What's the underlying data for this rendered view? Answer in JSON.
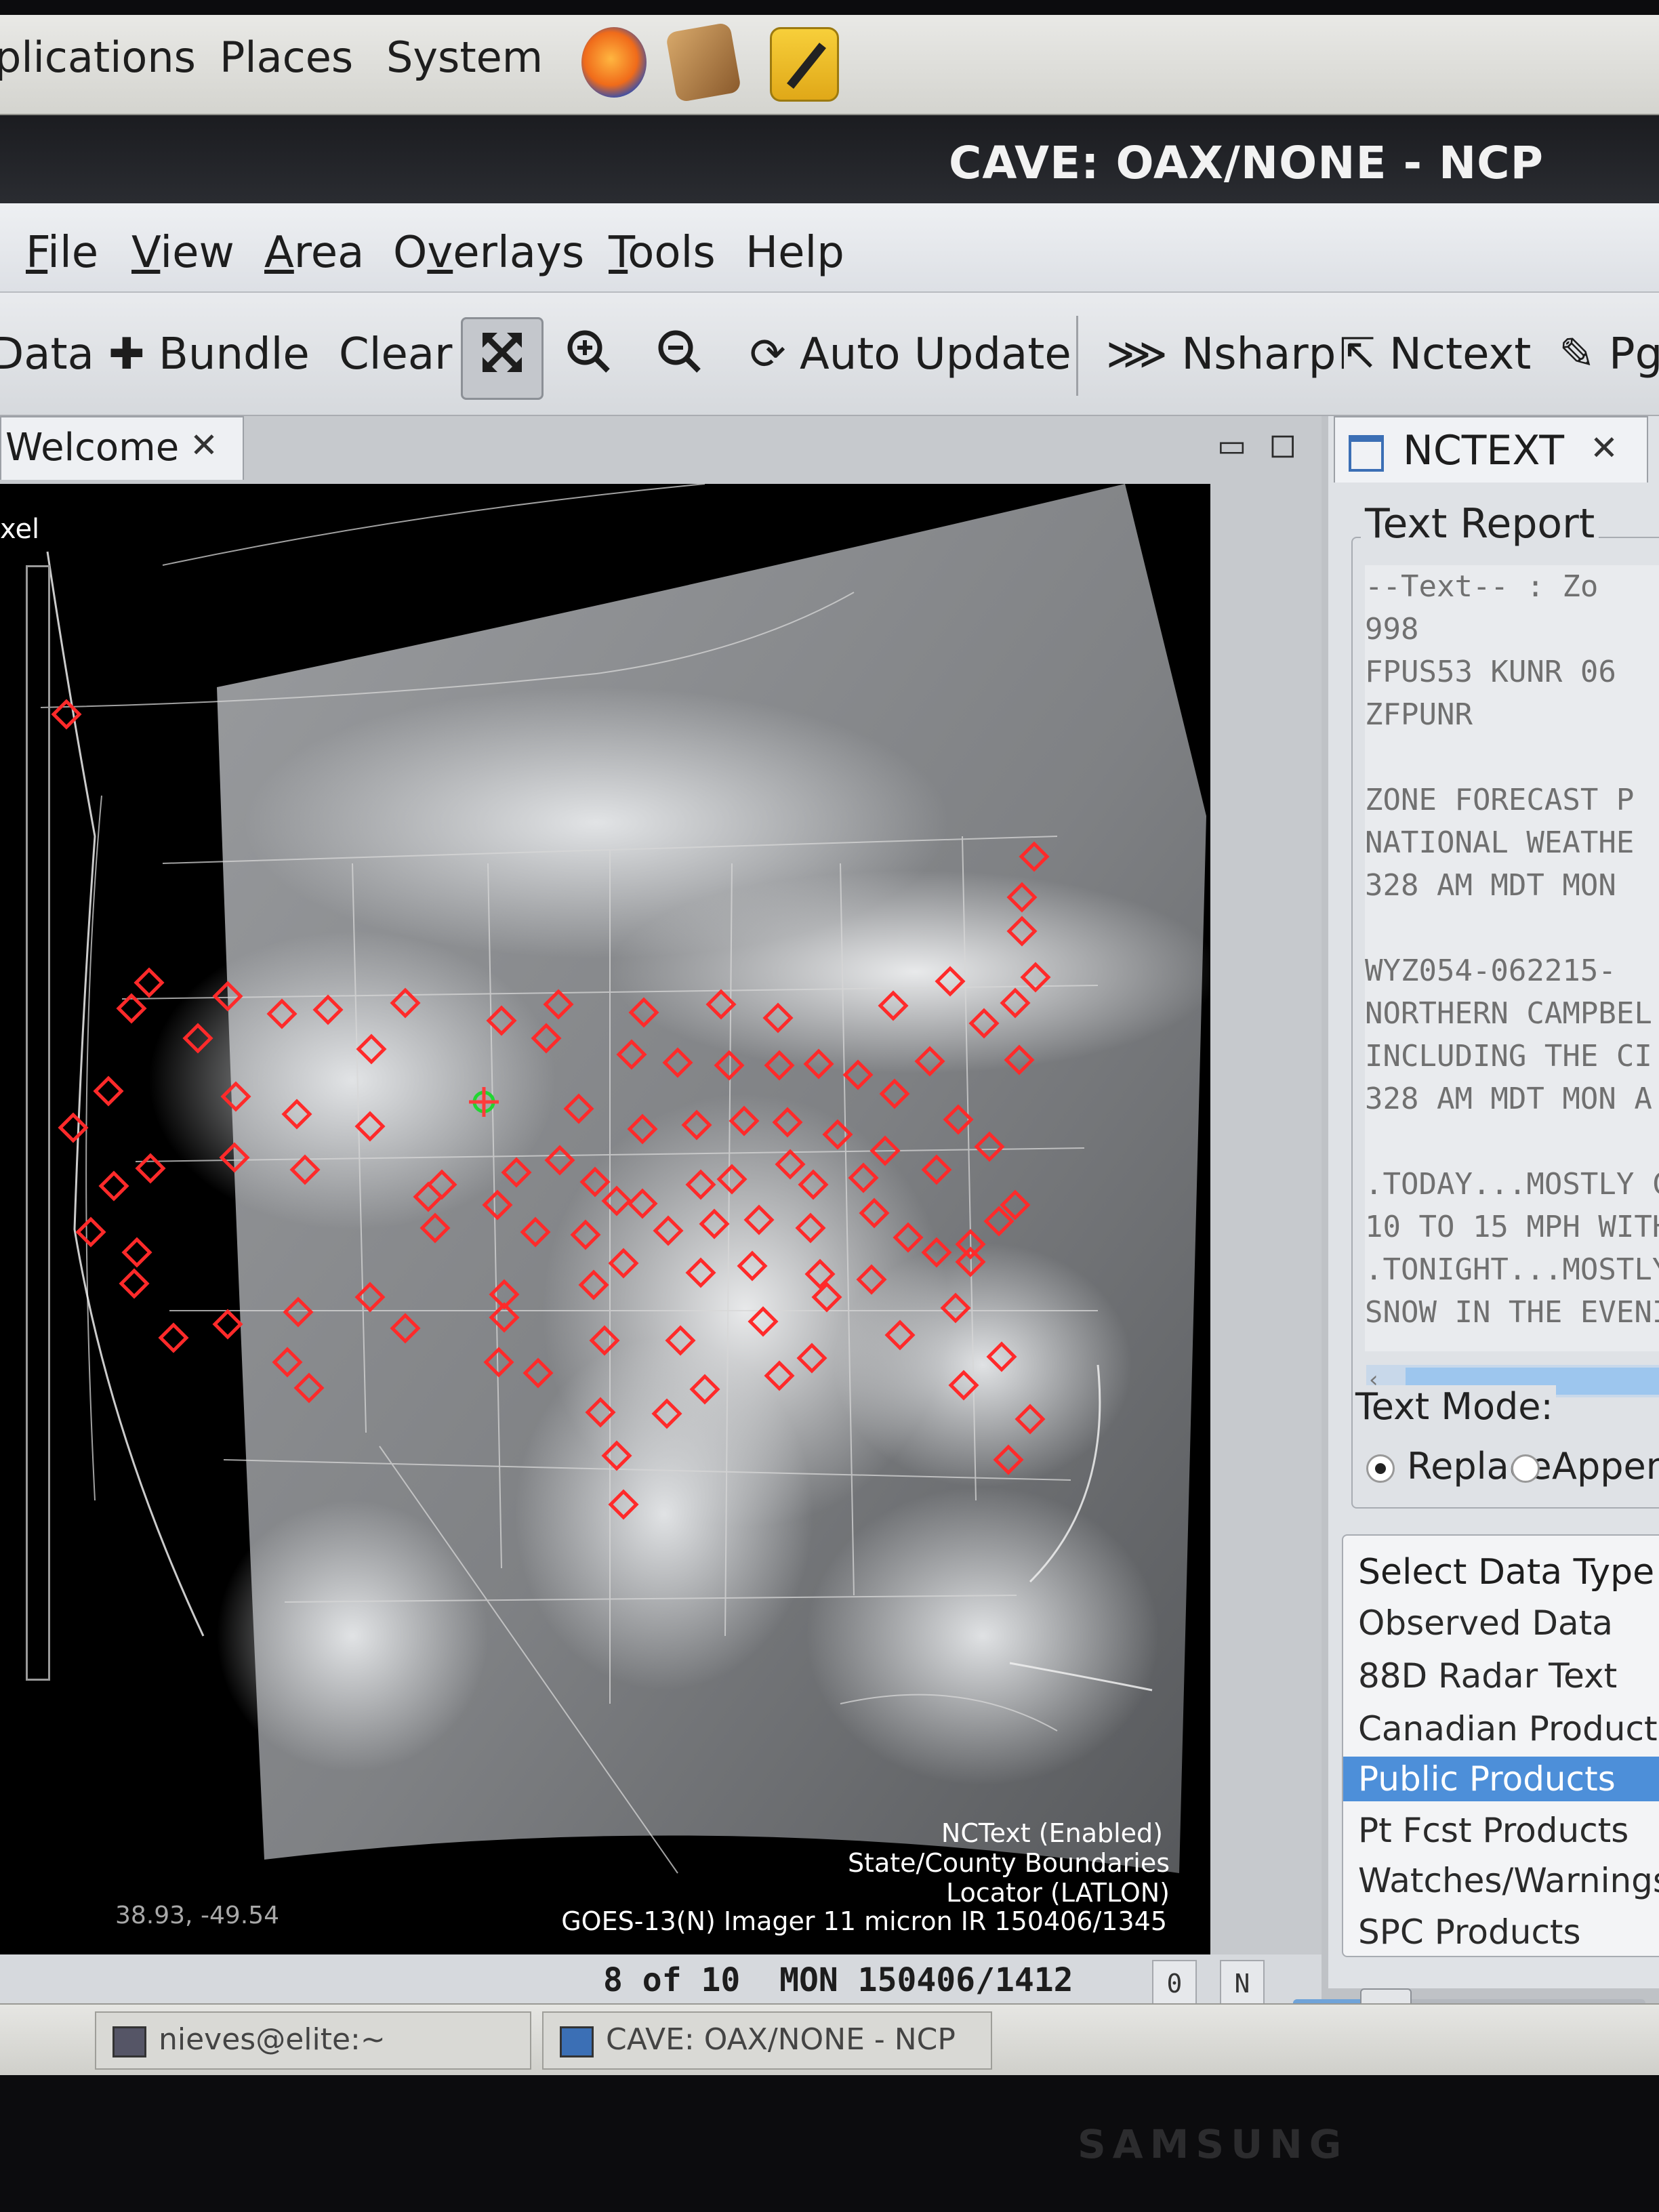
{
  "top_panel": {
    "menus": [
      "plications",
      "Places",
      "System"
    ],
    "launcher_icons": [
      "firefox-icon",
      "package-icon",
      "text-editor-icon"
    ]
  },
  "window": {
    "title": "CAVE: OAX/NONE - NCP"
  },
  "menubar": {
    "items": [
      {
        "label": "File",
        "mnemonic": "F"
      },
      {
        "label": "View",
        "mnemonic": "V"
      },
      {
        "label": "Area",
        "mnemonic": "A"
      },
      {
        "label": "Overlays",
        "mnemonic": "v"
      },
      {
        "label": "Tools",
        "mnemonic": "T"
      },
      {
        "label": "Help",
        "mnemonic": ""
      }
    ]
  },
  "toolbar": {
    "data_label": "Data",
    "bundle_label": "Bundle",
    "clear_label": "Clear",
    "auto_update_label": "Auto Update",
    "nsharp_label": "Nsharp",
    "nctext_label": "Nctext",
    "pg_label": "Pg",
    "icons": [
      "plus-icon",
      "fullscreen-icon",
      "zoom-in-icon",
      "zoom-out-icon",
      "refresh-icon",
      "nsharp-icon",
      "nctext-icon",
      "edit-icon"
    ]
  },
  "editor": {
    "tab_label": "Welcome",
    "sidebar_label": "xel",
    "status_lines": [
      "NCText (Enabled)",
      "State/County Boundaries",
      "Locator (LATLON)",
      "GOES-13(N) Imager 11 micron IR 150406/1345"
    ],
    "cursor_coords": "38.93, -49.54"
  },
  "frame": {
    "text": "8 of 10  MON 150406/1412",
    "btn_first": "0",
    "btn_last": "N",
    "slider_position": 0.26
  },
  "nctext": {
    "tab_label": "NCTEXT",
    "report_legend": "Text Report",
    "report_lines": [
      "--Text-- : Zo",
      "998",
      "FPUS53 KUNR 06",
      "ZFPUNR",
      "",
      "ZONE FORECAST P",
      "NATIONAL WEATHE",
      "328 AM MDT MON",
      "",
      "WYZ054-062215-",
      "NORTHERN CAMPBEL",
      "INCLUDING THE CI",
      "328 AM MDT MON A",
      "",
      ".TODAY...MOSTLY C",
      "10 TO 15 MPH WITH",
      ".TONIGHT...MOSTLY",
      "SNOW IN THE EVENIN"
    ],
    "text_mode_label": "Text Mode:",
    "text_mode_options": [
      "Replace",
      "Appen"
    ],
    "text_mode_selected": "Replace",
    "data_type_title": "Select Data Type Grou",
    "data_types": [
      "Observed Data",
      "88D Radar Text",
      "Canadian Products",
      "Public Products",
      "Pt Fcst Products",
      "Watches/Warnings",
      "SPC Products"
    ],
    "data_type_selected": "Public Products"
  },
  "taskbar": {
    "items": [
      "nieves@elite:~",
      "CAVE: OAX/NONE - NCP"
    ]
  },
  "monitor": {
    "brand": "SAMSUNG"
  },
  "colors": {
    "station_marker": "#ff2a2a",
    "cursor_marker": "#21d631",
    "selection": "#4d8fd9",
    "title_bar": "#1b1c20"
  }
}
